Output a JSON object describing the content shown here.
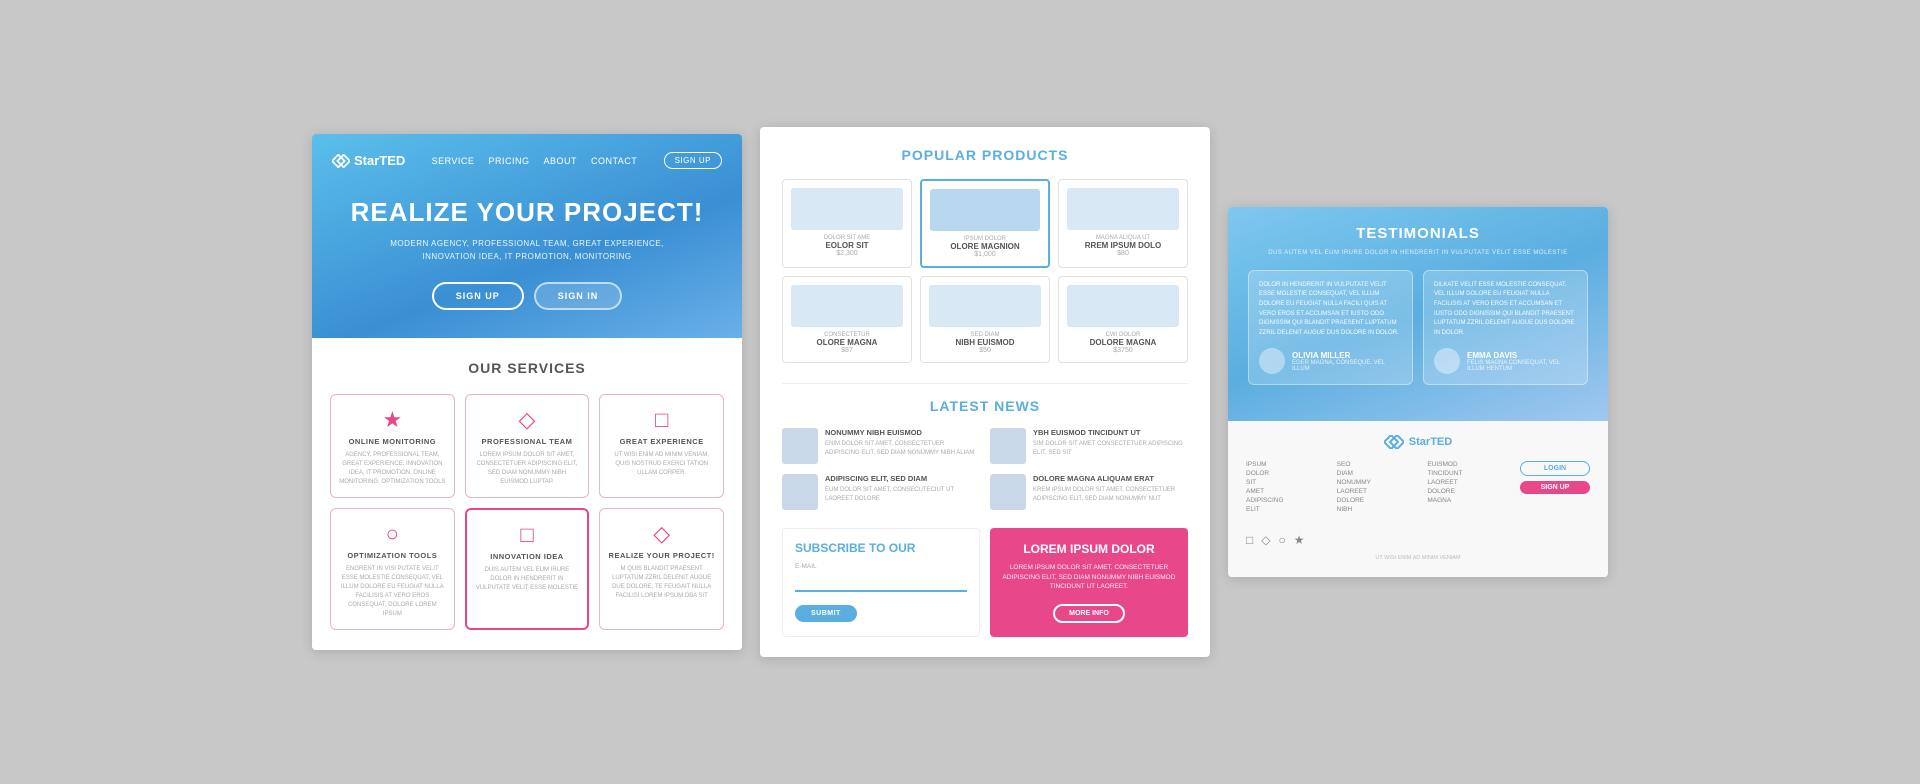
{
  "panel1": {
    "nav": {
      "logo": "StarTED",
      "links": [
        "SERVICE",
        "PRICING",
        "ABOUT",
        "CONTACT"
      ],
      "signup_btn": "SIGN UP"
    },
    "hero": {
      "title": "REALIZE YOUR PROJECT!",
      "subtitle_line1": "MODERN AGENCY, PROFESSIONAL TEAM, GREAT EXPERIENCE,",
      "subtitle_line2": "INNOVATION IDEA, IT PROMOTION, MONITORING",
      "btn_signup": "SIGN UP",
      "btn_signin": "SIGN IN"
    },
    "services": {
      "title": "OUR SERVICES",
      "items": [
        {
          "name": "ONLINE MONITORING",
          "desc": "AGENCY, PROFESSIONAL TEAM, GREAT EXPERIENCE, INNOVATION IDEA, IT PROMOTION, ONLINE MONITORING, OPTIMIZATION TOOLS",
          "icon": "★"
        },
        {
          "name": "PROFESSIONAL TEAM",
          "desc": "LOREM IPSUM DOLOR SIT AMET, CONSECTETUER ADIPISCING ELIT, SED DIAM NONUMMY NIBH EUISMOD LUPTAP.",
          "icon": "◇"
        },
        {
          "name": "GREAT EXPERIENCE",
          "desc": "UT WISI ENIM AD MINIM VENIAM, QUIS NOSTRUD EXERCI TATION ULLAM CORPER.",
          "icon": "□"
        },
        {
          "name": "OPTIMIZATION TOOLS",
          "desc": "ENGRENT IN VISI PUTATE VELIT ESSE MOLESTIE CONSEQUAT, VEL ILLUM DOLORE EU FEUGIAT NULLA FACILISIS AT VERO EROS CONSEQUAT, DOLORE LOREM IPSUM",
          "icon": "○"
        },
        {
          "name": "INNOVATION IDEA",
          "desc": "DUIS AUTEM VEL EUM IRURE DOLOR IN HENDRERIT IN VULPUTATE VELIT ESSE MOLESTIE",
          "icon": "□"
        },
        {
          "name": "REALIZE YOUR PROJECT!",
          "desc": "M QUIS BLANDIT PRAESENT LUPTATUM ZZRIL DELENIT AUGUE DUE DOLORE, TE FEUGAIT NULLA FACILISI LOREM IPSUM DBA SIT",
          "icon": "◇"
        }
      ]
    }
  },
  "panel2": {
    "products": {
      "title": "POPULAR PRODUCTS",
      "items": [
        {
          "label": "DOLOR SIT AME",
          "name": "EOLOR SIT",
          "price": "$2,300"
        },
        {
          "label": "IPSUM DOLOR",
          "name": "OLORE MAGNION",
          "price": "$1,000",
          "featured": true
        },
        {
          "label": "MAGNA ALIQUA UT",
          "name": "RREM IPSUM DOLO",
          "price": "$80"
        },
        {
          "label": "CONSECTETUR",
          "name": "OLORE MAGNA",
          "price": "$87"
        },
        {
          "label": "SED DIAM",
          "name": "NIBH EUISMOD",
          "price": "$50"
        },
        {
          "label": "CWI DOLOR",
          "name": "DOLORE MAGNA",
          "price": "$3750"
        }
      ]
    },
    "news": {
      "title": "LATEST NEWS",
      "items": [
        {
          "title": "NONUMMY NIBH EUISMOD",
          "text": "ENIM DOLOR SIT AMET, CONSECTETUER ADIPISCING ELIT, SED DIAM NONUMMY NIBH ALIAM"
        },
        {
          "title": "YBH EUISMOD TINCIDUNT UT",
          "text": "SIM DOLOR SIT AMET CONSECTETUER ADIPISCING ELIT, SED SIT"
        },
        {
          "title": "ADIPISCING ELIT, SED DIAM",
          "text": "EUM DOLOR SIT AMET, CONSECUTECIUT UT LAOREET DOLORE"
        },
        {
          "title": "DOLORE MAGNA ALIQUAM ERAT",
          "text": "KREM IPSUM DOLOR SIT AMET, CONSECTETUER ADIPISCING ELIT, SED DIAM NONUMMY NUT"
        }
      ]
    },
    "subscribe": {
      "title": "SUBSCRIBE TO OUR",
      "label": "E-MAIL",
      "placeholder": "",
      "submit_btn": "SUBMIT"
    },
    "promo": {
      "title": "LOREM IPSUM DOLOR",
      "text": "LOREM IPSUM DOLOR SIT AMET, CONSECTETUER ADIPISCING ELIT, SED DIAM NONUMMY NIBH EUISMOD TINCIDUNT UT LAOREET.",
      "more_info_btn": "MORE INFO"
    }
  },
  "panel3": {
    "testimonials": {
      "title": "Testimonials",
      "subtitle": "DUS AUTEM VEL EUM IRURE DOLOR IN HENDRERIT IN VULPUTATE VELIT ESSE MOLESTIE",
      "cards": [
        {
          "text": "DOLOR IN HENDRERIT IN VULPUTATE VELIT ESSE MOLESTIE CONSEQUAT, VEL ILLUM DOLORE EU FEUGIAT NULLA FACILI QUIS AT VERO EROS ET ACCUMSAN ET IUSTO ODO DIGNISSIM QUI BLANDIT PRAESENT LUPTATUM ZZRIL DELENIT AUGUE DUS DOLORE IN DOLOR.",
          "name": "OLIVIA MILLER",
          "role": "EGER MAGNA, CONSEQUE. VEL ILLUM"
        },
        {
          "text": "DILKATE VELIT ESSE MOLESTIE CONSEQUAT, VEL ILLUM DOLORE EU FEUGIAT NULLA FACILISIS AT VERO EROS ET ACCUMSAN ET IUSTO ODO DIGNISSIM QUI BLANDIT PRAESENT LUPTATUM ZZRIL DELENIT AUGUE DUS DOLORE IN DOLOR.",
          "name": "EMMA DAVIS",
          "role": "FELIS MAGNA CONSEQUAT, VEL ILLUM HENTUM"
        }
      ]
    },
    "footer": {
      "logo": "StarTED",
      "col1": [
        "IPSUM",
        "DOLOR",
        "SIT",
        "AMET",
        "ADIPISCING",
        "ELIT"
      ],
      "col2": [
        "SEO",
        "DIAM",
        "NONUMMY",
        "LAOREET",
        "DOLORE",
        "NIBH"
      ],
      "col3": [
        "EUISMOD",
        "TINCIDUNT",
        "LAOREET",
        "DOLORE",
        "MAGNA"
      ],
      "login_btn": "LOGIN",
      "signup_btn": "SIGN UP",
      "footer_text": "UT WISI ENIM AD MINIM VENIAM",
      "icons": [
        "□",
        "◇",
        "○",
        "★"
      ]
    }
  }
}
